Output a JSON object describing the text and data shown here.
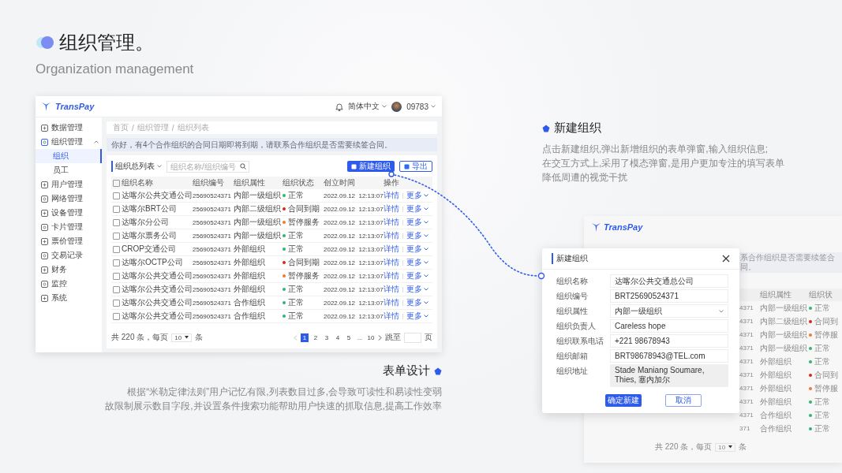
{
  "header": {
    "title": "组织管理。",
    "subtitle": "Organization management"
  },
  "admin_screen": {
    "logo": "TransPay",
    "language": "简体中文",
    "user": "09783",
    "sidebar": [
      {
        "label": "数据管理",
        "selected": false
      },
      {
        "label": "组织管理",
        "selected": false,
        "expanded": true,
        "children": [
          {
            "label": "组织",
            "selected": true
          },
          {
            "label": "员工",
            "selected": false
          }
        ]
      },
      {
        "label": "用户管理",
        "selected": false
      },
      {
        "label": "网络管理",
        "selected": false
      },
      {
        "label": "设备管理",
        "selected": false
      },
      {
        "label": "卡片管理",
        "selected": false
      },
      {
        "label": "票价管理",
        "selected": false
      },
      {
        "label": "交易记录",
        "selected": false
      },
      {
        "label": "财务",
        "selected": false
      },
      {
        "label": "监控",
        "selected": false
      },
      {
        "label": "系统",
        "selected": false
      }
    ],
    "breadcrumb": [
      "首页",
      "组织管理",
      "组织列表"
    ],
    "breadcrumb_separator": "/",
    "notice": "你好，有4个合作组织的合同日期即将到期，请联系合作组织是否需要续签合同。",
    "list_selector": "组织总列表",
    "search": {
      "placeholder": "组织名称/组织编号"
    },
    "buttons": [
      {
        "label": "新建组织",
        "kind": "primary"
      },
      {
        "label": "导出",
        "kind": "outline"
      }
    ],
    "table": {
      "select_all_checked": false,
      "columns": [
        "组织名称",
        "组织编号",
        "组织属性",
        "组织状态",
        "创立时间",
        "操作"
      ],
      "rows": [
        {
          "checked": false,
          "name": "达喀尔公共交通公司",
          "code": "25690524371",
          "attribute": "内部一级组织",
          "status": "正常",
          "color": "#2bb673",
          "created": "2022.09.12  12:13:07",
          "actions": [
            "详情",
            "更多"
          ]
        },
        {
          "checked": false,
          "name": "达喀尔BRT公司",
          "code": "25690524371",
          "attribute": "内部二级组织",
          "status": "合同到期",
          "color": "#d9261c",
          "created": "2022.09.12  12:13:07",
          "actions": [
            "详情",
            "更多"
          ]
        },
        {
          "checked": false,
          "name": "达喀尔分公司",
          "code": "25690524371",
          "attribute": "内部一级组织",
          "status": "暂停服务",
          "color": "#f07a2a",
          "created": "2022.09.12  12:13:07",
          "actions": [
            "详情",
            "更多"
          ]
        },
        {
          "checked": false,
          "name": "达喀尔票务公司",
          "code": "25690524371",
          "attribute": "内部一级组织",
          "status": "正常",
          "color": "#2bb673",
          "created": "2022.09.12  12:13:07",
          "actions": [
            "详情",
            "更多"
          ]
        },
        {
          "checked": false,
          "name": "CROP交通公司",
          "code": "25690524371",
          "attribute": "外部组织",
          "status": "正常",
          "color": "#2bb673",
          "created": "2022.09.12  12:13:07",
          "actions": [
            "详情",
            "更多"
          ]
        },
        {
          "checked": false,
          "name": "达喀尔OCTP公司",
          "code": "25690524371",
          "attribute": "外部组织",
          "status": "合同到期",
          "color": "#d9261c",
          "created": "2022.09.12  12:13:07",
          "actions": [
            "详情",
            "更多"
          ]
        },
        {
          "checked": false,
          "name": "达喀尔公共交通公司",
          "code": "25690524371",
          "attribute": "外部组织",
          "status": "暂停服务",
          "color": "#f07a2a",
          "created": "2022.09.12  12:13:07",
          "actions": [
            "详情",
            "更多"
          ]
        },
        {
          "checked": false,
          "name": "达喀尔公共交通公司",
          "code": "25690524371",
          "attribute": "外部组织",
          "status": "正常",
          "color": "#2bb673",
          "created": "2022.09.12  12:13:07",
          "actions": [
            "详情",
            "更多"
          ]
        },
        {
          "checked": false,
          "name": "达喀尔公共交通公司",
          "code": "25690524371",
          "attribute": "合作组织",
          "status": "正常",
          "color": "#2bb673",
          "created": "2022.09.12  12:13:07",
          "actions": [
            "详情",
            "更多"
          ]
        },
        {
          "checked": false,
          "name": "达喀尔公共交通公司",
          "code": "25690524371",
          "attribute": "合作组织",
          "status": "正常",
          "color": "#2bb673",
          "created": "2022.09.12  12:13:07",
          "actions": [
            "详情",
            "更多"
          ]
        }
      ]
    },
    "pagination": {
      "total": "共 220 条，每页",
      "page_size": "10",
      "unit": "条",
      "pages": [
        {
          "label": "1",
          "selected": true
        },
        {
          "label": "2",
          "selected": false
        },
        {
          "label": "3",
          "selected": false
        },
        {
          "label": "4",
          "selected": false
        },
        {
          "label": "5",
          "selected": false
        },
        {
          "label": "...",
          "selected": false
        },
        {
          "label": "10",
          "selected": false
        }
      ],
      "jump_label": "跳至",
      "page_unit": "页"
    }
  },
  "bottom_section": {
    "title": "表单设计",
    "lines": [
      "根据“米勒定律法则”用户记忆有限,列表数目过多,会导致可读性和易读性变弱",
      "故限制展示数目字段,并设置条件搜索功能帮助用户快速的抓取信息,提高工作效率"
    ]
  },
  "modal_section": {
    "title": "新建组织",
    "lines": [
      "点击新建组织,弹出新增组织的表单弹窗,输入组织信息;",
      "在交互方式上,采用了模态弹窗,是用户更加专注的填写表单",
      "降低周遭的视觉干扰"
    ]
  },
  "modal_screen": {
    "logo": "TransPay",
    "notice_fragment": "系合作组织是否需要续签合同。",
    "columns": [
      "组织属性",
      "组织状"
    ],
    "rows": [
      {
        "code_fragment": "4371",
        "attribute": "内部一级组织",
        "status": "正常",
        "color": "#2bb673"
      },
      {
        "code_fragment": "4371",
        "attribute": "内部二级组织",
        "status": "合同到",
        "color": "#d9261c"
      },
      {
        "code_fragment": "4371",
        "attribute": "内部一级组织",
        "status": "暂停服",
        "color": "#f07a2a"
      },
      {
        "code_fragment": "4371",
        "attribute": "内部一级组织",
        "status": "正常",
        "color": "#2bb673"
      },
      {
        "code_fragment": "4371",
        "attribute": "外部组织",
        "status": "正常",
        "color": "#2bb673"
      },
      {
        "code_fragment": "4371",
        "attribute": "外部组织",
        "status": "合同到",
        "color": "#d9261c"
      },
      {
        "code_fragment": "4371",
        "attribute": "外部组织",
        "status": "暂停服",
        "color": "#f07a2a"
      },
      {
        "code_fragment": "4371",
        "attribute": "外部组织",
        "status": "正常",
        "color": "#2bb673"
      },
      {
        "code_fragment": "4371",
        "attribute": "合作组织",
        "status": "正常",
        "color": "#2bb673"
      },
      {
        "code_fragment": "371",
        "attribute": "合作组织",
        "status": "正常",
        "color": "#2bb673"
      }
    ],
    "pagination": {
      "total": "共 220 条，每页",
      "page_size": "10",
      "unit": "条"
    },
    "modal": {
      "title": "新建组织",
      "fields": [
        {
          "label": "组织名称",
          "value": "达喀尔公共交通总公司",
          "kind": "text"
        },
        {
          "label": "组织编号",
          "value": "BRT25690524371",
          "kind": "text"
        },
        {
          "label": "组织属性",
          "value": "内部一级组织",
          "kind": "select"
        },
        {
          "label": "组织负责人",
          "value": "Careless hope",
          "kind": "text"
        },
        {
          "label": "组织联系电话",
          "value": "+221 98678943",
          "kind": "text"
        },
        {
          "label": "组织邮箱",
          "value": "BRT98678943@TEL.com",
          "kind": "text"
        },
        {
          "label": "组织地址",
          "value": "Stade Maniang Soumare, Thies, 塞内加尔",
          "kind": "textarea"
        }
      ],
      "buttons": [
        {
          "label": "确定新建",
          "kind": "primary"
        },
        {
          "label": "取消",
          "kind": "outline"
        }
      ]
    }
  }
}
